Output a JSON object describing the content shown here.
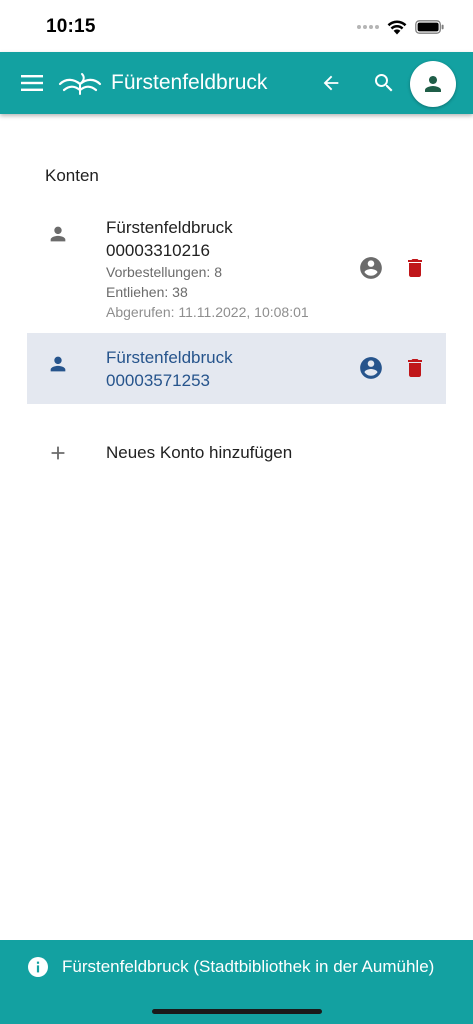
{
  "status_bar": {
    "time": "10:15",
    "icons": [
      "signal-dots-icon",
      "wifi-icon",
      "battery-icon"
    ]
  },
  "app_bar": {
    "title": "Fürstenfeldbruck",
    "background_color": "#13a1a1",
    "icons": [
      "menu-icon",
      "library-logo",
      "arrow-back-icon",
      "search-icon",
      "person-icon"
    ]
  },
  "accounts_section": {
    "title": "Konten",
    "accounts": [
      {
        "name": "Fürstenfeldbruck",
        "number": "00003310216",
        "reservations": "Vorbestellungen: 8",
        "loans": "Entliehen: 38",
        "retrieved": "Abgerufen: 11.11.2022, 10:08:01",
        "selected": false
      },
      {
        "name": "Fürstenfeldbruck",
        "number": "00003571253",
        "selected": true
      }
    ],
    "add_account_label": "Neues Konto hinzufügen"
  },
  "colors": {
    "accent": "#13a1a1",
    "selected_row": "#e4e8f0",
    "selected_text": "#26548c",
    "delete": "#c0161a"
  },
  "snackbar": {
    "text": "Fürstenfeldbruck (Stadtbibliothek in der Aumühle)",
    "icon": "info-icon"
  }
}
